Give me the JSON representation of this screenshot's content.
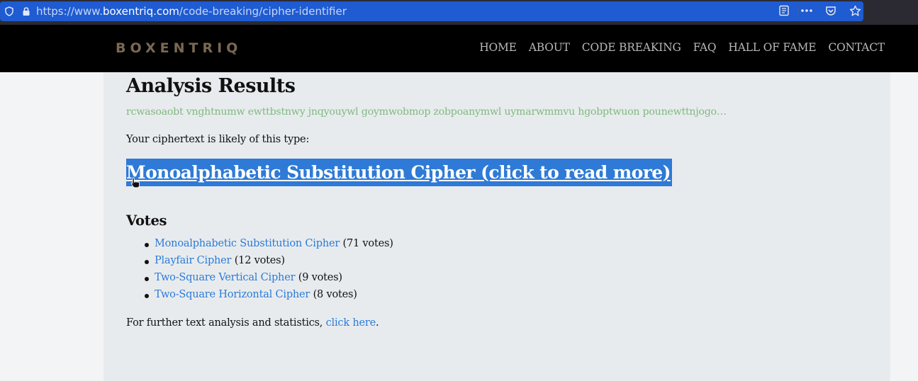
{
  "browser": {
    "url_prefix": "https://www.",
    "url_host": "boxentriq.com",
    "url_path": "/code-breaking/cipher-identifier"
  },
  "header": {
    "logo": "BOXENTRIQ",
    "nav": [
      "HOME",
      "ABOUT",
      "CODE BREAKING",
      "FAQ",
      "HALL OF FAME",
      "CONTACT"
    ]
  },
  "main": {
    "title": "Analysis Results",
    "ciphertext": "rcwasoaobt vnghtnumw ewttbstnwy jnqyouywl goymwobmop zobpoanymwl uymarwmmvu hgobptwuon pounewttnjogo…",
    "likely_label": "Your ciphertext is likely of this type:",
    "result_link": "Monoalphabetic Substitution Cipher (click to read more)",
    "votes_title": "Votes",
    "votes": [
      {
        "name": "Monoalphabetic Substitution Cipher",
        "count": "(71 votes)"
      },
      {
        "name": "Playfair Cipher",
        "count": "(12 votes)"
      },
      {
        "name": "Two-Square Vertical Cipher",
        "count": "(9 votes)"
      },
      {
        "name": "Two-Square Horizontal Cipher",
        "count": "(8 votes)"
      }
    ],
    "further_prefix": "For further text analysis and statistics, ",
    "further_link": "click here",
    "further_suffix": "."
  },
  "colors": {
    "header_bg": "#000000",
    "logo": "#7a6a52",
    "link": "#2a7bd8",
    "ciphertext": "#7fba7f",
    "highlight": "#2e7ad6",
    "urlbar": "#1f5bd1"
  }
}
